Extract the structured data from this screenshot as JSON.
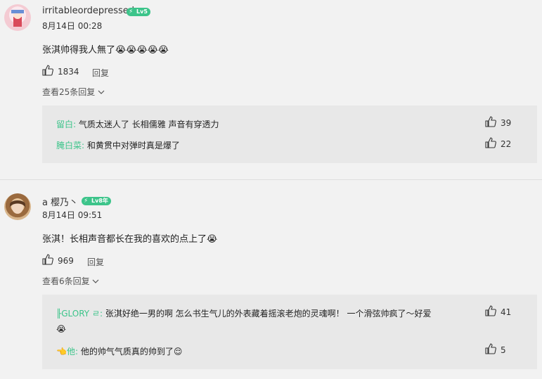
{
  "comments": [
    {
      "username": "irritableordepressed",
      "level": "Lv5",
      "time": "8月14日 00:28",
      "text": "张淇帅得我人無了😭😭😭😭😭",
      "likes": "1834",
      "reply_label": "回复",
      "view_replies": "查看25条回复",
      "replies": [
        {
          "user": "留白:",
          "text": "气质太迷人了 长相儒雅 声音有穿透力",
          "likes": "39"
        },
        {
          "user": "腌白菜:",
          "text": "和黄贯中对弹时真是爆了",
          "likes": "22"
        }
      ]
    },
    {
      "username": "a 樱乃丶",
      "level": "Lv8年",
      "time": "8月14日 09:51",
      "text": "张淇！长相声音都长在我的喜欢的点上了😭",
      "likes": "969",
      "reply_label": "回复",
      "view_replies": "查看6条回复",
      "replies": [
        {
          "user": "╟GLORY ㄹ:",
          "text": "张淇好绝一男的啊 怎么书生气儿的外表藏着摇滚老炮的灵魂啊！ 一个滑弦帅疯了～好爱",
          "text2": "😭",
          "likes": "41"
        },
        {
          "user": "👈他:",
          "text": "他的帅气气质真的帅到了😌",
          "likes": "5"
        }
      ]
    }
  ],
  "colors": {
    "accent": "#3cc48a",
    "background": "#f2f2f2",
    "reply_box": "#e8e8e8"
  },
  "icons": {
    "like": "thumbs-up-icon",
    "badge": "lightning-icon",
    "chevron": "chevron-down-icon"
  }
}
